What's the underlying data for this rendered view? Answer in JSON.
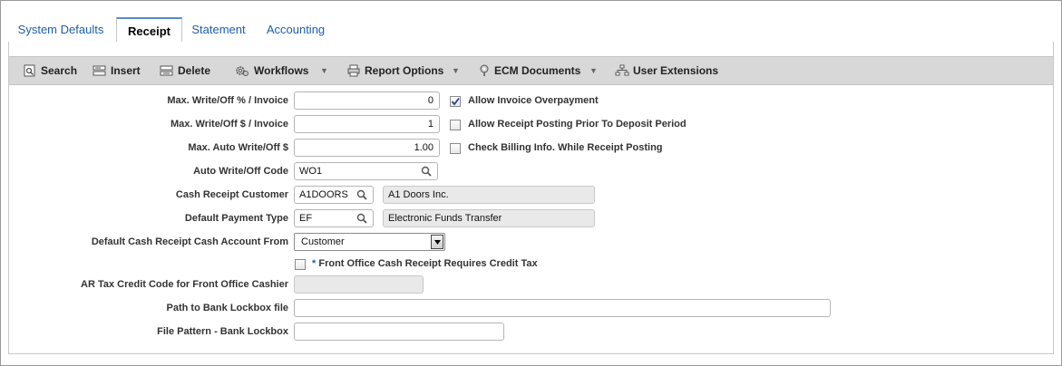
{
  "tabs": [
    {
      "label": "System Defaults",
      "active": false
    },
    {
      "label": "Receipt",
      "active": true
    },
    {
      "label": "Statement",
      "active": false
    },
    {
      "label": "Accounting",
      "active": false
    }
  ],
  "toolbar": {
    "search": "Search",
    "insert": "Insert",
    "delete": "Delete",
    "workflows": "Workflows",
    "report_options": "Report Options",
    "ecm_documents": "ECM Documents",
    "user_extensions": "User Extensions"
  },
  "form": {
    "max_writeoff_pct": {
      "label": "Max. Write/Off % / Invoice",
      "value": "0"
    },
    "max_writeoff_amt": {
      "label": "Max. Write/Off $ / Invoice",
      "value": "1"
    },
    "max_auto_writeoff": {
      "label": "Max. Auto Write/Off $",
      "value": "1.00"
    },
    "auto_writeoff_code": {
      "label": "Auto Write/Off Code",
      "value": "WO1"
    },
    "cash_receipt_customer": {
      "label": "Cash Receipt Customer",
      "value": "A1DOORS",
      "description": "A1 Doors Inc."
    },
    "default_payment_type": {
      "label": "Default Payment Type",
      "value": "EF",
      "description": "Electronic Funds Transfer"
    },
    "default_cash_account_from": {
      "label": "Default Cash Receipt Cash Account From",
      "value": "Customer"
    },
    "front_office_requires_credit_tax": {
      "required_marker": "*",
      "label": "Front Office Cash Receipt Requires Credit Tax",
      "checked": false
    },
    "ar_tax_credit_code": {
      "label": "AR Tax Credit Code for Front Office Cashier",
      "value": ""
    },
    "path_bank_lockbox": {
      "label": "Path to Bank Lockbox file",
      "value": ""
    },
    "file_pattern_lockbox": {
      "label": "File Pattern - Bank Lockbox",
      "value": ""
    }
  },
  "checkboxes": {
    "allow_invoice_overpayment": {
      "label": "Allow Invoice Overpayment",
      "checked": true
    },
    "allow_receipt_prior_deposit": {
      "label": "Allow Receipt Posting Prior To Deposit Period",
      "checked": false
    },
    "check_billing_info": {
      "label": "Check Billing Info. While Receipt Posting",
      "checked": false
    }
  },
  "colors": {
    "tab_link": "#1d5fa8",
    "toolbar_bg": "#d8d8d8",
    "readonly_bg": "#e9e9e9"
  }
}
